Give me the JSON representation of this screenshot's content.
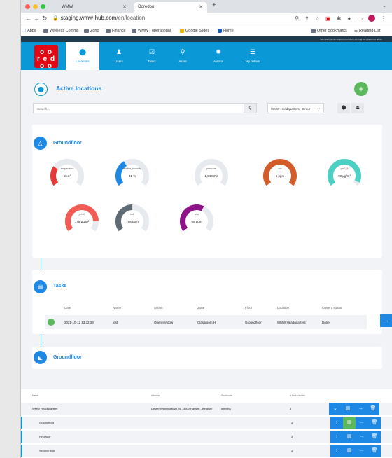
{
  "browser": {
    "tabs": [
      {
        "label": "WMW"
      },
      {
        "label": "Ooredoo"
      }
    ],
    "url_domain": "staging.wmw-hub.com",
    "url_path": "/en/location",
    "bookmarks": [
      "Apps",
      "Wireless Comms",
      "Zoho",
      "Finance",
      "WMW - operational",
      "Google Slides",
      "Home"
    ],
    "other_bookmarks": "Other Bookmarks",
    "reading_list": "Reading List"
  },
  "app": {
    "top_info": "Test Client (wmw support) (bot client)   EN   Log out | Return to admin",
    "logo_text": [
      "o o",
      "r e d",
      "o o"
    ],
    "nav": [
      {
        "label": "Locations",
        "icon": "location-pin-icon",
        "glyph": "⬤"
      },
      {
        "label": "Users",
        "icon": "users-icon",
        "glyph": "👥"
      },
      {
        "label": "Tasks",
        "icon": "tasks-icon",
        "glyph": "✓"
      },
      {
        "label": "Asset",
        "icon": "asset-icon",
        "glyph": "⚲"
      },
      {
        "label": "Alarms",
        "icon": "alarms-icon",
        "glyph": "✺"
      },
      {
        "label": "My details",
        "icon": "details-icon",
        "glyph": "☰"
      }
    ],
    "page_title": "Active locations",
    "search_placeholder": "Search...",
    "location_select": "WMW Headquarters - Grour",
    "groundfloor_title": "Groundfloor",
    "gauges": [
      {
        "label": "temperature",
        "value": "15.6°",
        "color": "#e53935",
        "fraction": 0.28
      },
      {
        "label": "relative_humidity",
        "value": "41 %",
        "color": "#1e88e5",
        "fraction": 0.38
      },
      {
        "label": "pressure",
        "value": "1,048hPa",
        "color": "#e6e9ee",
        "fraction": 0.0
      },
      {
        "label": "voc",
        "value": "6 ppm",
        "color": "#d35d2a",
        "fraction": 1.0
      },
      {
        "label": "pm2_5",
        "value": "90 µg/m³",
        "color": "#4dd0c4",
        "fraction": 0.95
      },
      {
        "label": "pm10",
        "value": "178 µg/m³",
        "color": "#f25c54",
        "fraction": 0.85
      },
      {
        "label": "co2",
        "value": "798 ppm",
        "color": "#5f6b75",
        "fraction": 0.5
      },
      {
        "label": "tvoc",
        "value": "59 ppm",
        "color": "#8e1388",
        "fraction": 0.6
      }
    ],
    "tasks_title": "Tasks",
    "tasks_columns": [
      "Date",
      "Name",
      "Action",
      "Zone",
      "Floor",
      "Location",
      "Current status"
    ],
    "tasks_rows": [
      {
        "date": "2021-10-12 13:32:39",
        "name": "test",
        "action": "Open window",
        "zone": "Classroom H",
        "floor": "Groundfloor",
        "location": "WMW Headquarters",
        "status": "Done"
      }
    ],
    "chart_section_title": "Groundfloor",
    "locations_columns": [
      "Name",
      "Address",
      "Shortcode",
      "# floors/zones"
    ],
    "locations_rows": [
      {
        "name": "WMW Headquarters",
        "address": "Dekter Willemsstraat 26 - 3500 Hasselt - Belgium",
        "shortcode": "wmwhq",
        "count": "3"
      },
      {
        "name": "Groundfloor",
        "address": "",
        "shortcode": "",
        "count": "3"
      },
      {
        "name": "First floor",
        "address": "",
        "shortcode": "",
        "count": "3"
      },
      {
        "name": "Second floor",
        "address": "",
        "shortcode": "",
        "count": "3"
      }
    ]
  }
}
